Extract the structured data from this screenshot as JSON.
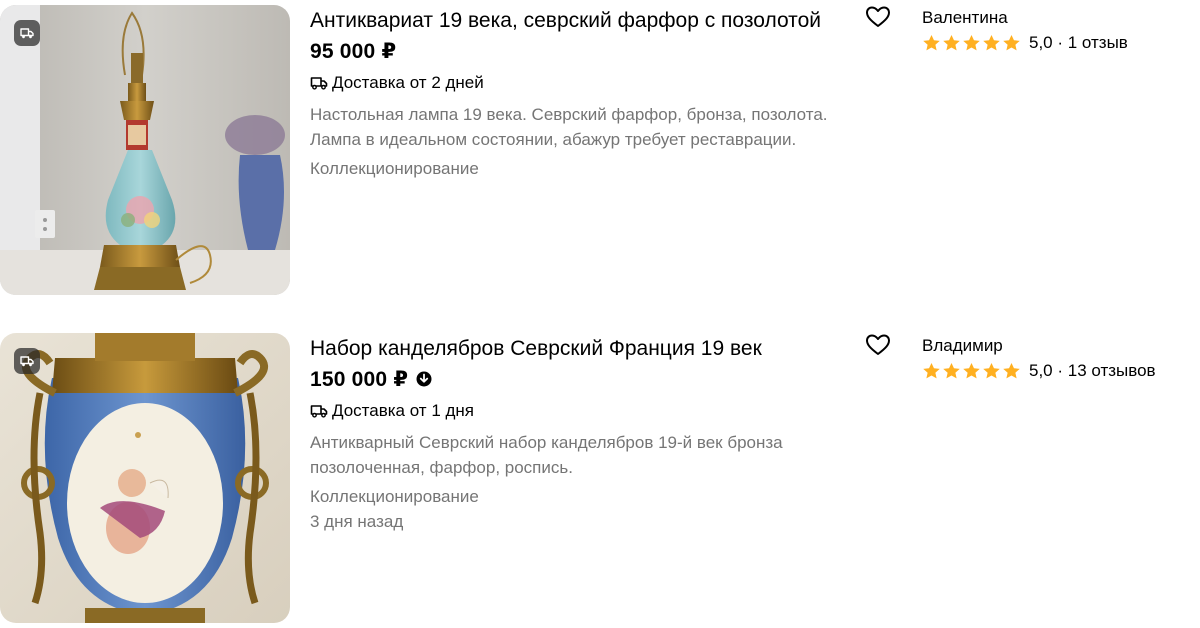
{
  "listings": [
    {
      "title": "Антиквариат 19 века, севрский фарфор с позолотой",
      "price": "95 000 ₽",
      "price_drop_icon": "",
      "delivery": "Доставка от 2 дней",
      "description": "Настольная лампа 19 века. Севрский фарфор, бронза, позолота. Лампа в идеальном состоянии, абажур требует реставрации.",
      "category": "Коллекционирование",
      "posted": "",
      "seller": {
        "name": "Валентина",
        "rating": "5,0",
        "reviews": "1 отзыв"
      },
      "photo_icon": "delivery-truck-icon",
      "favorite_icon": "heart-icon"
    },
    {
      "title": "Набор канделябров Севрский Франция 19 век",
      "price": "150 000 ₽",
      "price_drop_icon": "price-down-icon",
      "delivery": "Доставка от 1 дня",
      "description": "Антикварный Севрский набор канделябров 19-й век бронза позолоченная, фарфор, роспись.",
      "category": "Коллекционирование",
      "posted": "3 дня назад",
      "seller": {
        "name": "Владимир",
        "rating": "5,0",
        "reviews": "13 отзывов"
      },
      "photo_icon": "delivery-truck-icon",
      "favorite_icon": "heart-icon"
    }
  ],
  "separator": " · ",
  "colors": {
    "star": "#ffb021",
    "muted_text": "#757575",
    "text": "#000000"
  }
}
